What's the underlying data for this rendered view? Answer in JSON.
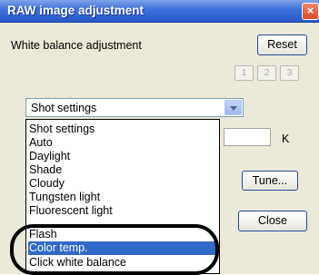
{
  "window": {
    "title": "RAW image adjustment",
    "close_symbol": "×"
  },
  "white_balance": {
    "label": "White balance adjustment",
    "reset_label": "Reset",
    "preset_buttons": [
      "1",
      "2",
      "3"
    ],
    "selected_value": "Shot settings",
    "options": [
      "Shot settings",
      "Auto",
      "Daylight",
      "Shade",
      "Cloudy",
      "Tungsten light",
      "Fluorescent light",
      "Flash",
      "Color temp.",
      "Click white balance"
    ],
    "highlighted_option": "Color temp.",
    "kelvin_value": "",
    "kelvin_unit": "K",
    "tune_label": "Tune...",
    "close_label": "Close"
  },
  "colors": {
    "title_bar": "#3a6fd8",
    "selection": "#316ac5",
    "window_bg": "#ece9d8"
  }
}
